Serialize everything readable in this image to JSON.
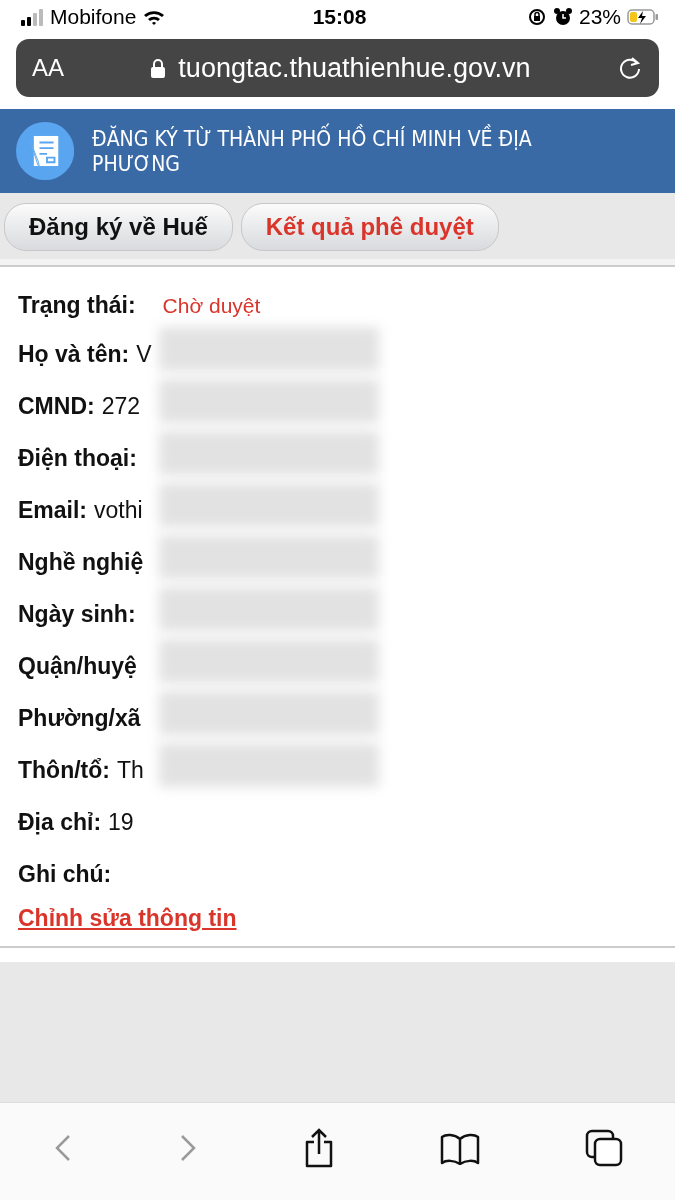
{
  "status_bar": {
    "carrier": "Mobifone",
    "time": "15:08",
    "battery": "23%"
  },
  "address_bar": {
    "text_size": "AA",
    "url": "tuongtac.thuathienhue.gov.vn"
  },
  "banner": {
    "title": "ĐĂNG KÝ TỪ THÀNH PHỐ HỒ CHÍ MINH VỀ ĐỊA PHƯƠNG"
  },
  "tabs": [
    {
      "label": "Đăng ký về Huế",
      "selected": false
    },
    {
      "label": "Kết quả phê duyệt",
      "selected": true
    }
  ],
  "fields": [
    {
      "label": "Trạng thái:",
      "value": "Chờ duyệt",
      "kind": "status",
      "redacted": false
    },
    {
      "label": "Họ và tên:",
      "value": "V",
      "kind": "text",
      "redacted": true
    },
    {
      "label": "CMND:",
      "value": "272",
      "kind": "text",
      "redacted": true
    },
    {
      "label": "Điện thoại:",
      "kind": "text",
      "redacted": true
    },
    {
      "label": "Email:",
      "value": "vothi",
      "kind": "text",
      "redacted": true
    },
    {
      "label": "Nghề nghiệ",
      "kind": "text",
      "redacted": true
    },
    {
      "label": "Ngày sinh:",
      "kind": "text",
      "redacted": true
    },
    {
      "label": "Quận/huyệ",
      "kind": "text",
      "redacted": true
    },
    {
      "label": "Phường/xã",
      "kind": "text",
      "redacted": true
    },
    {
      "label": "Thôn/tổ:",
      "value": "Th",
      "kind": "text",
      "redacted": true
    },
    {
      "label": "Địa chỉ:",
      "value": "19",
      "kind": "text",
      "redacted": false
    },
    {
      "label": "Ghi chú:",
      "kind": "text",
      "redacted": false
    }
  ],
  "edit_link": "Chỉnh sửa thông tin",
  "toolbar": {
    "back_disabled": true,
    "forward_disabled": true
  }
}
